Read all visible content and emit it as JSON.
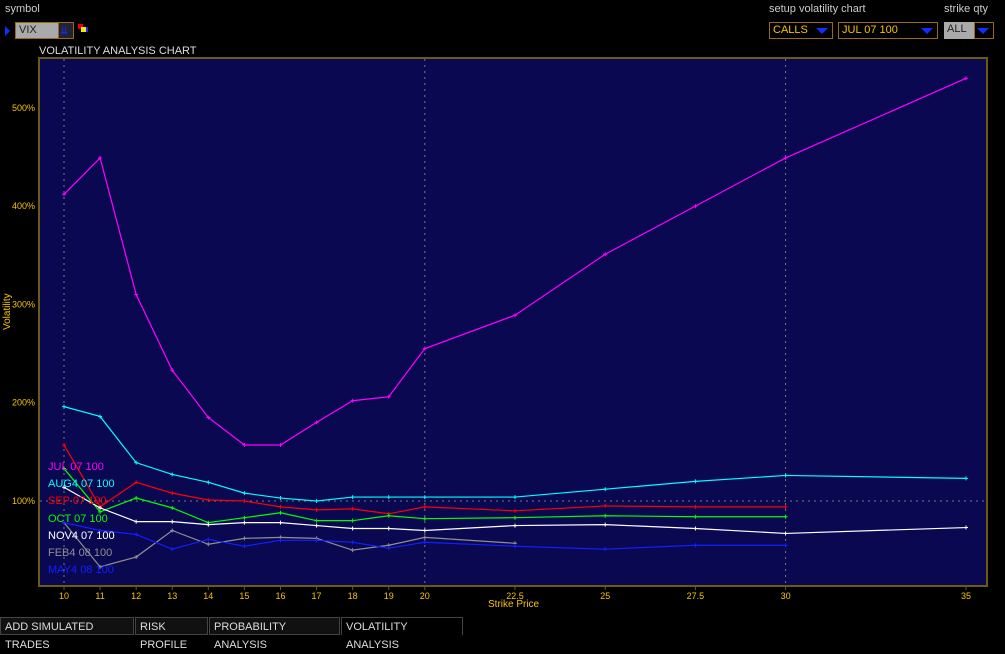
{
  "header": {
    "symbol_label": "symbol",
    "symbol_value": "VIX",
    "setup_label": "setup volatility chart",
    "type_value": "CALLS",
    "series_value": "JUL 07 100",
    "strike_qty_label": "strike qty",
    "strike_qty_value": "ALL"
  },
  "chart_title": "VOLATILITY ANALYSIS CHART",
  "tabs": [
    "ADD SIMULATED TRADES",
    "RISK PROFILE",
    "PROBABILITY ANALYSIS",
    "VOLATILITY ANALYSIS"
  ],
  "active_tab": "VOLATILITY ANALYSIS",
  "chart_data": {
    "type": "line",
    "xlabel": "Strike Price",
    "ylabel": "Volatility",
    "x": [
      10,
      11,
      12,
      13,
      14,
      15,
      16,
      17,
      18,
      19,
      20,
      22.5,
      25,
      27.5,
      30,
      35
    ],
    "x_tick_labels": [
      "10",
      "11",
      "12",
      "13",
      "14",
      "15",
      "16",
      "17",
      "18",
      "19",
      "20",
      "22.5",
      "25",
      "27.5",
      "30",
      "35"
    ],
    "y_ticks": [
      100,
      200,
      300,
      400,
      500
    ],
    "y_tick_labels": [
      "100%",
      "200%",
      "300%",
      "400%",
      "500%"
    ],
    "grid": "dotted at 10, 20, 30 and 100%",
    "legend": "bottom-left",
    "series": [
      {
        "name": "JUL 07 100",
        "color": "#ff00ff",
        "values": [
          412,
          449,
          310,
          233,
          185,
          157,
          157,
          180,
          202,
          206,
          255,
          289,
          351,
          400,
          449,
          530
        ]
      },
      {
        "name": "AUG4 07 100",
        "color": "#00ffff",
        "values": [
          196,
          186,
          139,
          127,
          119,
          108,
          103,
          100,
          104,
          104,
          104,
          104,
          112,
          120,
          126,
          123
        ]
      },
      {
        "name": "SEP 07 100",
        "color": "#ff0000",
        "values": [
          157,
          94,
          119,
          108,
          101,
          100,
          94,
          91,
          92,
          87,
          94,
          90,
          95,
          94,
          94,
          null
        ]
      },
      {
        "name": "OCT 07 100",
        "color": "#00ff00",
        "values": [
          133,
          89,
          103,
          93,
          78,
          83,
          88,
          80,
          80,
          85,
          82,
          83,
          85,
          84,
          84,
          null
        ]
      },
      {
        "name": "NOV4 07 100",
        "color": "#ffffff",
        "values": [
          114,
          93,
          79,
          79,
          76,
          78,
          78,
          75,
          72,
          72,
          70,
          75,
          76,
          72,
          67,
          73
        ]
      },
      {
        "name": "FEB4 08 100",
        "color": "#909090",
        "values": [
          78,
          33,
          43,
          70,
          56,
          62,
          63,
          62,
          50,
          55,
          63,
          57,
          null,
          null,
          null,
          null
        ]
      },
      {
        "name": "MAY4 08 100",
        "color": "#1020ff",
        "values": [
          78,
          70,
          66,
          51,
          61,
          54,
          60,
          60,
          58,
          52,
          58,
          54,
          51,
          55,
          55,
          null
        ]
      }
    ]
  }
}
